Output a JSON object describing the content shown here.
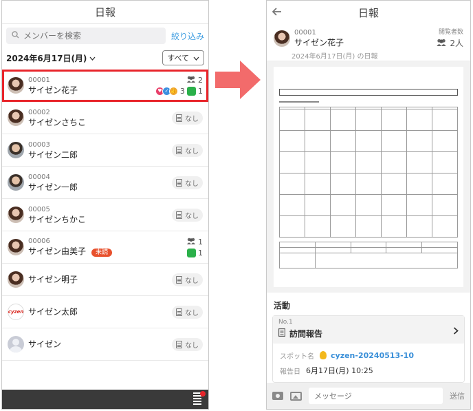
{
  "left": {
    "title": "日報",
    "search_placeholder": "メンバーを検索",
    "filter_label": "絞り込み",
    "date_label": "2024年6月17日(月)",
    "select_value": "すべて",
    "none_label": "なし",
    "unread_label": "未読",
    "members": [
      {
        "id": "00001",
        "name": "サイゼン花子",
        "avatar": "female",
        "views": "2",
        "comments": "1",
        "reactions": "3",
        "selected": true
      },
      {
        "id": "00002",
        "name": "サイゼンさちこ",
        "avatar": "female"
      },
      {
        "id": "00003",
        "name": "サイゼン二郎",
        "avatar": "male"
      },
      {
        "id": "00004",
        "name": "サイゼン一郎",
        "avatar": "male"
      },
      {
        "id": "00005",
        "name": "サイゼンちかこ",
        "avatar": "female"
      },
      {
        "id": "00006",
        "name": "サイゼン由美子",
        "avatar": "female",
        "unread": true,
        "views": "1",
        "comments": "1"
      },
      {
        "id": "",
        "name": "サイゼン明子",
        "avatar": "female"
      },
      {
        "id": "",
        "name": "サイゼン太郎",
        "avatar": "cyzen"
      },
      {
        "id": "",
        "name": "サイゼン",
        "avatar": "blank"
      }
    ],
    "cyzen_logo_text": "cyzen"
  },
  "right": {
    "title": "日報",
    "user_id": "00001",
    "user_name": "サイゼン花子",
    "report_date_label": "2024年6月17日(月) の日報",
    "views_label": "閲覧者数",
    "views_count": "2人",
    "activity_title": "活動",
    "card": {
      "no": "No.1",
      "title": "訪問報告",
      "spot_label": "スポット名",
      "spot_value": "cyzen-20240513-10",
      "date_label": "報告日",
      "date_value": "6月17日(月) 10:25"
    },
    "message_placeholder": "メッセージ",
    "send_label": "送信"
  },
  "colors": {
    "accent_blue": "#3a9be0",
    "highlight_red": "#e8252b",
    "arrow": "#f26b6b",
    "unread_badge": "#e8512d",
    "comment_green": "#2bb04a"
  }
}
